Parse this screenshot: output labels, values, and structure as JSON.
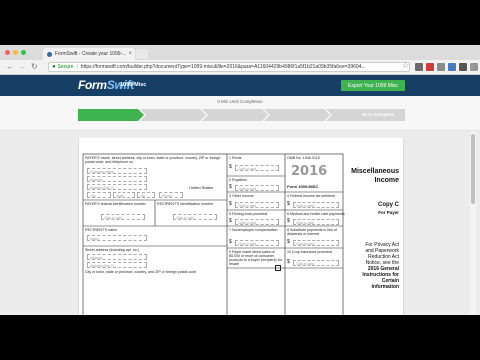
{
  "browser": {
    "tab_title": "FormSwift - Create your 1099-...",
    "tab_close": "×",
    "url_secure_label": "Secure",
    "url_text": "https://formswift.com/builder.php?documentType=1099-misc&file=2016&para=A11604429b4986f1a5f1b21a09b35fa6ee=39604...",
    "nav_back": "←",
    "nav_forward": "→",
    "nav_reload": "↻",
    "star": "☆",
    "menu": "⋮",
    "colors": {
      "red": "#ff5f57",
      "yellow": "#febc2e",
      "green": "#28c840"
    }
  },
  "app": {
    "logo_form": "Form",
    "logo_swift": "Swift",
    "logo_sub": "FormSwift",
    "form_name_prefix": "1099-",
    "form_name_suffix": "Misc",
    "export_button": "Export Your 1099 Misc"
  },
  "progress": {
    "text": "0 Min Until Completion",
    "last_step": "50 % Complete",
    "fraction_complete": 0.0
  },
  "form": {
    "payer_name_label": "PAYER'S name, street address, city or town, state or province, country, ZIP or foreign postal code, and telephone no.",
    "company_name_placeholder": "Company name",
    "address_placeholder": "Address",
    "address2_placeholder": "Address (line 2)",
    "city_placeholder": "City",
    "state_placeholder": "State",
    "zip_placeholder": "Zip",
    "phone_placeholder": "Phone",
    "country_value": "United States",
    "box1": "1 Rents",
    "box2": "2 Royalties",
    "box3": "3 Other income",
    "box4": "4 Federal income tax withheld",
    "box5": "5 Fishing boat proceeds",
    "box6": "6 Medical and health care payments",
    "box7": "7 Nonemployee compensation",
    "box8": "8 Substitute payments in lieu of dividends or interest",
    "box9": "9 Payer made direct sales of $5,000 or more of consumer products to a buyer (recipient) for resale",
    "box10": "10 Crop insurance proceeds",
    "omb": "OMB No. 1545-0115",
    "year": "2016",
    "form_label": "Form 1099-MISC",
    "payer_tin_label": "PAYER'S federal identification number",
    "recipient_tin_label": "RECIPIENT'S identification number",
    "recipient_name_label": "RECIPIENT'S name",
    "recipient_name_placeholder": "Name",
    "street_label": "Street address (including apt. no.)",
    "city_label": "City or town, state or province, country, and ZIP or foreign postal code",
    "click_to_add": "Click to add",
    "dollar": "$",
    "misc_title_1": "Miscellaneous",
    "misc_title_2": "Income",
    "copy_c": "Copy C",
    "for_payer": "For Payer",
    "privacy_1": "For Privacy Act",
    "privacy_2": "and Paperwork",
    "privacy_3": "Reduction Act",
    "privacy_4": "Notice, see the",
    "privacy_5": "2016 General",
    "privacy_6": "Instructions for",
    "privacy_7": "Certain",
    "privacy_8": "Information"
  }
}
